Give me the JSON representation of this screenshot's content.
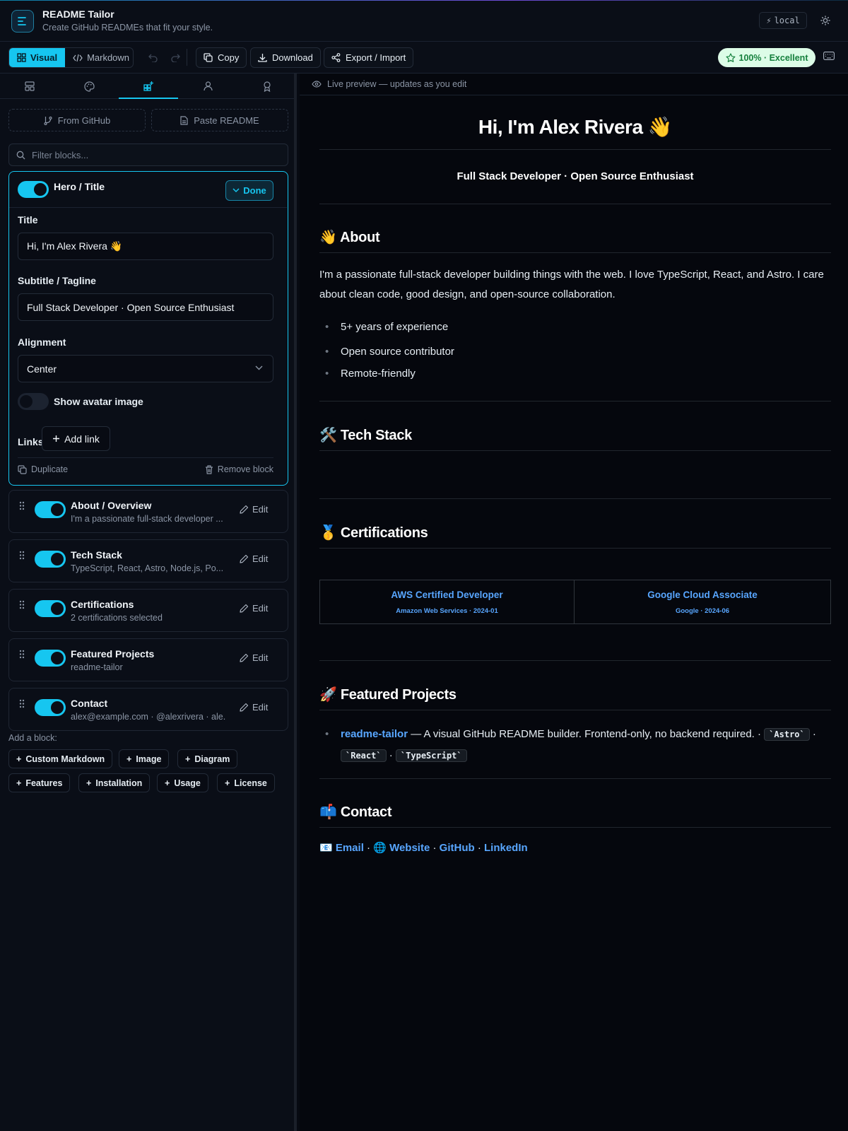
{
  "app": {
    "title": "README Tailor",
    "subtitle": "Create GitHub READMEs that fit your style.",
    "local_badge": "local",
    "brand_color": "#16c6f0"
  },
  "toolbar": {
    "mode_visual": "Visual",
    "mode_markdown": "Markdown",
    "copy": "Copy",
    "download": "Download",
    "export_import": "Export / Import",
    "score": "100% · Excellent"
  },
  "left": {
    "from_github": "From GitHub",
    "paste_readme": "Paste README",
    "filter_placeholder": "Filter blocks...",
    "hero": {
      "name": "Hero / Title",
      "done": "Done",
      "title_label": "Title",
      "title_value": "Hi, I'm Alex Rivera 👋",
      "subtitle_label": "Subtitle / Tagline",
      "subtitle_value": "Full Stack Developer · Open Source Enthusiast",
      "alignment_label": "Alignment",
      "alignment_value": "Center",
      "avatar_label": "Show avatar image",
      "links_label": "Links",
      "add_link": "Add link",
      "duplicate": "Duplicate",
      "remove": "Remove block"
    },
    "blocks": [
      {
        "title": "About / Overview",
        "sub": "I'm a passionate full-stack developer ...",
        "edit": "Edit"
      },
      {
        "title": "Tech Stack",
        "sub": "TypeScript, React, Astro, Node.js, Po...",
        "edit": "Edit"
      },
      {
        "title": "Certifications",
        "sub": "2 certifications selected",
        "edit": "Edit"
      },
      {
        "title": "Featured Projects",
        "sub": "readme-tailor",
        "edit": "Edit"
      },
      {
        "title": "Contact",
        "sub": "alex@example.com · @alexrivera · ale...",
        "edit": "Edit"
      }
    ],
    "add_block_label": "Add a block:",
    "add_chips": [
      "Custom Markdown",
      "Image",
      "Diagram",
      "Features",
      "Installation",
      "Usage",
      "License"
    ]
  },
  "preview": {
    "bar_label": "Live preview — updates as you edit",
    "h1": "Hi, I'm Alex Rivera 👋",
    "tagline": "Full Stack Developer · Open Source Enthusiast",
    "about_h": "👋 About",
    "about_p": "I'm a passionate full-stack developer building things with the web. I love TypeScript, React, and Astro. I care about clean code, good design, and open-source collaboration.",
    "about_bullets": [
      "5+ years of experience",
      "Open source contributor",
      "Remote-friendly"
    ],
    "tech_h": "🛠️ Tech Stack",
    "cert_h": "🥇 Certifications",
    "certs": [
      {
        "name": "AWS Certified Developer",
        "meta": "Amazon Web Services · 2024-01"
      },
      {
        "name": "Google Cloud Associate",
        "meta": "Google · 2024-06"
      }
    ],
    "projects_h": "🚀 Featured Projects",
    "project_name": "readme-tailor",
    "project_desc": " — A visual GitHub README builder. Frontend-only, no backend required. · ",
    "project_tags": [
      "`Astro`",
      "`React`",
      "`TypeScript`"
    ],
    "contact_h": "📫 Contact",
    "contact_email": "📧 Email",
    "contact_website": "🌐 Website",
    "contact_github": "GitHub",
    "contact_linkedin": "LinkedIn",
    "contact_sep": " · "
  }
}
